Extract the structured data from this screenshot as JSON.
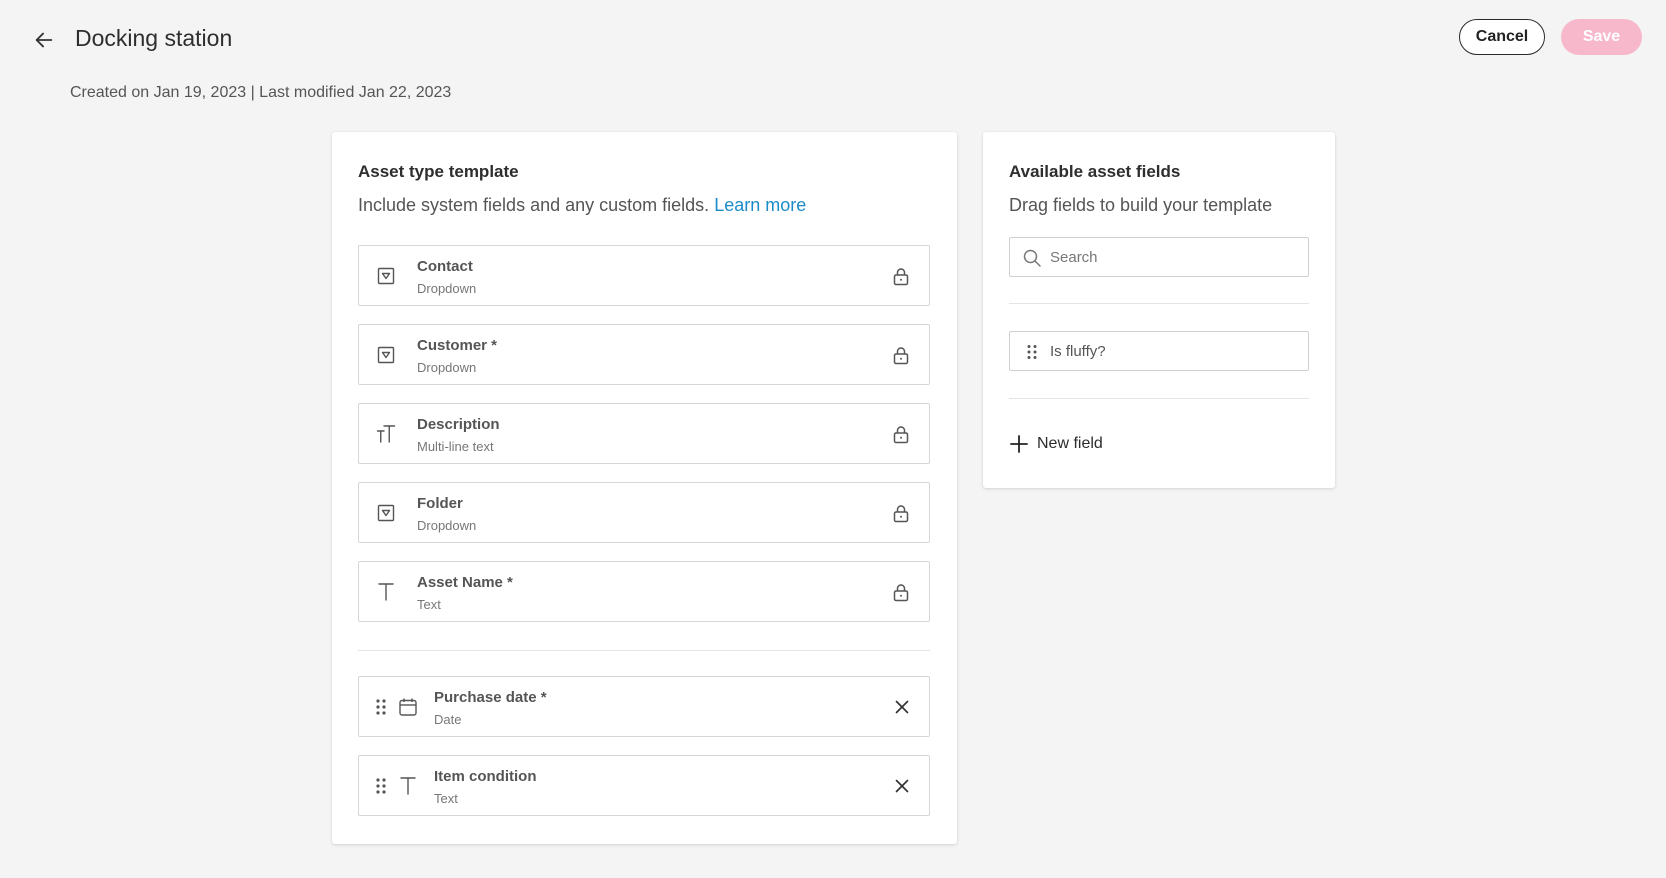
{
  "header": {
    "title": "Docking station",
    "meta": "Created on Jan 19, 2023 | Last modified Jan 22, 2023",
    "cancel_label": "Cancel",
    "save_label": "Save"
  },
  "template": {
    "title": "Asset type template",
    "subtitle": "Include system fields and any custom fields.",
    "learn_more": "Learn more",
    "system_fields": [
      {
        "name": "Contact",
        "type": "Dropdown",
        "icon": "dropdown-icon"
      },
      {
        "name": "Customer *",
        "type": "Dropdown",
        "icon": "dropdown-icon"
      },
      {
        "name": "Description",
        "type": "Multi-line text",
        "icon": "multiline-text-icon"
      },
      {
        "name": "Folder",
        "type": "Dropdown",
        "icon": "dropdown-icon"
      },
      {
        "name": "Asset Name *",
        "type": "Text",
        "icon": "text-icon"
      }
    ],
    "custom_fields": [
      {
        "name": "Purchase date *",
        "type": "Date",
        "icon": "calendar-icon"
      },
      {
        "name": "Item condition",
        "type": "Text",
        "icon": "text-icon"
      }
    ]
  },
  "available": {
    "title": "Available asset fields",
    "subtitle": "Drag fields to build your template",
    "search_placeholder": "Search",
    "items": [
      {
        "label": "Is fluffy?"
      }
    ],
    "new_field_label": "New field"
  },
  "colors": {
    "accent": "#1a8bc8",
    "save_disabled": "#f8b8cc"
  }
}
